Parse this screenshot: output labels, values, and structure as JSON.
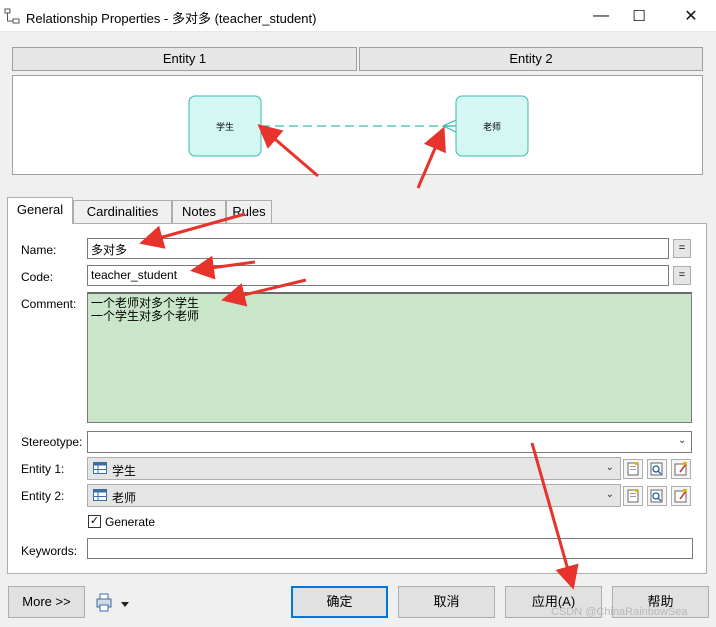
{
  "window": {
    "title": "Relationship Properties - 多对多 (teacher_student)",
    "minimize": "—",
    "maximize": "☐",
    "close": "✕"
  },
  "diagram": {
    "entity1_header": "Entity 1",
    "entity2_header": "Entity 2",
    "entity1_box": "学生",
    "entity2_box": "老师",
    "box_color": "#d4f7f4",
    "box_border": "#3cb8b0",
    "link_color": "#3cb8b0"
  },
  "tabs": [
    "General",
    "Cardinalities",
    "Notes",
    "Rules"
  ],
  "form": {
    "name_label": "Name:",
    "name_value": "多对多",
    "code_label": "Code:",
    "code_value": "teacher_student",
    "comment_label": "Comment:",
    "comment_value": "一个老师对多个学生\n一个学生对多个老师",
    "stereotype_label": "Stereotype:",
    "stereotype_value": "",
    "entity1_label": "Entity 1:",
    "entity1_value": "学生",
    "entity2_label": "Entity 2:",
    "entity2_value": "老师",
    "generate_label": "Generate",
    "generate_checked": true,
    "keywords_label": "Keywords:",
    "keywords_value": "",
    "eq_button": "="
  },
  "buttons": {
    "more": "More >>",
    "ok": "确定",
    "cancel": "取消",
    "apply": "应用(A)",
    "help": "帮助"
  },
  "watermark": "CSDN @ChinaRainbowSea",
  "annotation_color": "#e8322c"
}
